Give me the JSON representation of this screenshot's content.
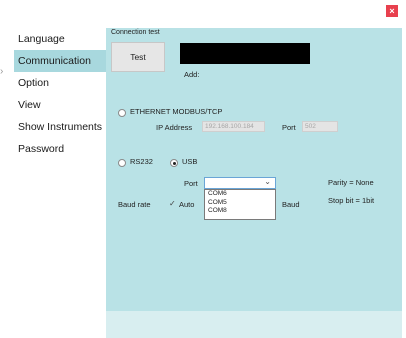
{
  "window": {
    "close_glyph": "×"
  },
  "sidebar": {
    "items": [
      {
        "label": "Language",
        "active": false
      },
      {
        "label": "Communication",
        "active": true
      },
      {
        "label": "Option",
        "active": false
      },
      {
        "label": "View",
        "active": false
      },
      {
        "label": "Show Instruments",
        "active": false
      },
      {
        "label": "Password",
        "active": false
      }
    ]
  },
  "connection": {
    "section_label": "Connection test",
    "test_label": "Test",
    "add_label": "Add:"
  },
  "ethernet": {
    "label": "ETHERNET MODBUS/TCP",
    "selected": false,
    "ip_label": "IP Address",
    "ip_value": "192.168.100.184",
    "port_label": "Port",
    "port_value": "502"
  },
  "serial": {
    "rs232_label": "RS232",
    "rs232_selected": false,
    "usb_label": "USB",
    "usb_selected": true,
    "port_label": "Port",
    "port_selected": "",
    "port_options": [
      "COM6",
      "COM5",
      "COM8"
    ],
    "baud_label": "Baud rate",
    "auto_checked": true,
    "auto_label": "Auto",
    "baud_unit": "Baud",
    "parity_text": "Parity = None",
    "stop_bit_text": "Stop bit = 1bit"
  },
  "colors": {
    "panel_bg": "#b9e2e6",
    "active_item_bg": "#a8d8de",
    "close_red": "#e8404e"
  }
}
